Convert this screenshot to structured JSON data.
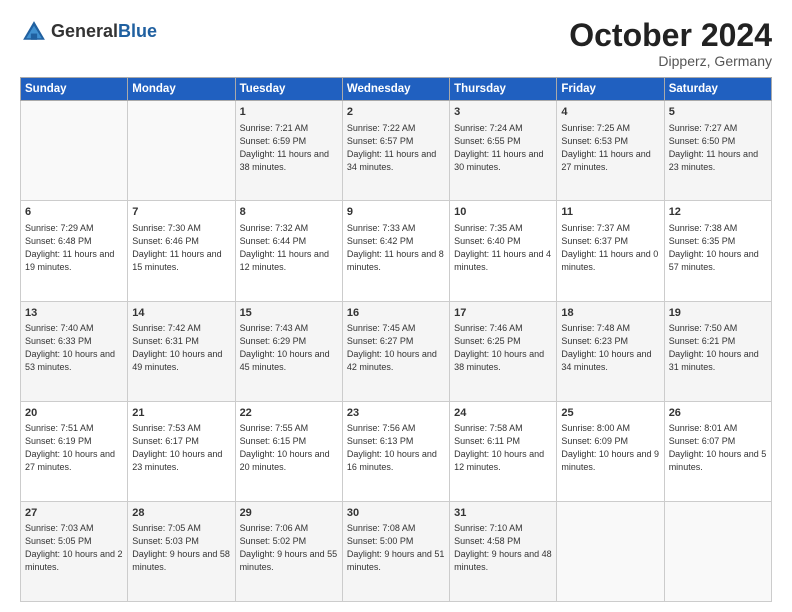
{
  "header": {
    "logo_general": "General",
    "logo_blue": "Blue",
    "month_title": "October 2024",
    "location": "Dipperz, Germany"
  },
  "weekdays": [
    "Sunday",
    "Monday",
    "Tuesday",
    "Wednesday",
    "Thursday",
    "Friday",
    "Saturday"
  ],
  "weeks": [
    [
      {
        "day": "",
        "info": ""
      },
      {
        "day": "",
        "info": ""
      },
      {
        "day": "1",
        "info": "Sunrise: 7:21 AM\nSunset: 6:59 PM\nDaylight: 11 hours and 38 minutes."
      },
      {
        "day": "2",
        "info": "Sunrise: 7:22 AM\nSunset: 6:57 PM\nDaylight: 11 hours and 34 minutes."
      },
      {
        "day": "3",
        "info": "Sunrise: 7:24 AM\nSunset: 6:55 PM\nDaylight: 11 hours and 30 minutes."
      },
      {
        "day": "4",
        "info": "Sunrise: 7:25 AM\nSunset: 6:53 PM\nDaylight: 11 hours and 27 minutes."
      },
      {
        "day": "5",
        "info": "Sunrise: 7:27 AM\nSunset: 6:50 PM\nDaylight: 11 hours and 23 minutes."
      }
    ],
    [
      {
        "day": "6",
        "info": "Sunrise: 7:29 AM\nSunset: 6:48 PM\nDaylight: 11 hours and 19 minutes."
      },
      {
        "day": "7",
        "info": "Sunrise: 7:30 AM\nSunset: 6:46 PM\nDaylight: 11 hours and 15 minutes."
      },
      {
        "day": "8",
        "info": "Sunrise: 7:32 AM\nSunset: 6:44 PM\nDaylight: 11 hours and 12 minutes."
      },
      {
        "day": "9",
        "info": "Sunrise: 7:33 AM\nSunset: 6:42 PM\nDaylight: 11 hours and 8 minutes."
      },
      {
        "day": "10",
        "info": "Sunrise: 7:35 AM\nSunset: 6:40 PM\nDaylight: 11 hours and 4 minutes."
      },
      {
        "day": "11",
        "info": "Sunrise: 7:37 AM\nSunset: 6:37 PM\nDaylight: 11 hours and 0 minutes."
      },
      {
        "day": "12",
        "info": "Sunrise: 7:38 AM\nSunset: 6:35 PM\nDaylight: 10 hours and 57 minutes."
      }
    ],
    [
      {
        "day": "13",
        "info": "Sunrise: 7:40 AM\nSunset: 6:33 PM\nDaylight: 10 hours and 53 minutes."
      },
      {
        "day": "14",
        "info": "Sunrise: 7:42 AM\nSunset: 6:31 PM\nDaylight: 10 hours and 49 minutes."
      },
      {
        "day": "15",
        "info": "Sunrise: 7:43 AM\nSunset: 6:29 PM\nDaylight: 10 hours and 45 minutes."
      },
      {
        "day": "16",
        "info": "Sunrise: 7:45 AM\nSunset: 6:27 PM\nDaylight: 10 hours and 42 minutes."
      },
      {
        "day": "17",
        "info": "Sunrise: 7:46 AM\nSunset: 6:25 PM\nDaylight: 10 hours and 38 minutes."
      },
      {
        "day": "18",
        "info": "Sunrise: 7:48 AM\nSunset: 6:23 PM\nDaylight: 10 hours and 34 minutes."
      },
      {
        "day": "19",
        "info": "Sunrise: 7:50 AM\nSunset: 6:21 PM\nDaylight: 10 hours and 31 minutes."
      }
    ],
    [
      {
        "day": "20",
        "info": "Sunrise: 7:51 AM\nSunset: 6:19 PM\nDaylight: 10 hours and 27 minutes."
      },
      {
        "day": "21",
        "info": "Sunrise: 7:53 AM\nSunset: 6:17 PM\nDaylight: 10 hours and 23 minutes."
      },
      {
        "day": "22",
        "info": "Sunrise: 7:55 AM\nSunset: 6:15 PM\nDaylight: 10 hours and 20 minutes."
      },
      {
        "day": "23",
        "info": "Sunrise: 7:56 AM\nSunset: 6:13 PM\nDaylight: 10 hours and 16 minutes."
      },
      {
        "day": "24",
        "info": "Sunrise: 7:58 AM\nSunset: 6:11 PM\nDaylight: 10 hours and 12 minutes."
      },
      {
        "day": "25",
        "info": "Sunrise: 8:00 AM\nSunset: 6:09 PM\nDaylight: 10 hours and 9 minutes."
      },
      {
        "day": "26",
        "info": "Sunrise: 8:01 AM\nSunset: 6:07 PM\nDaylight: 10 hours and 5 minutes."
      }
    ],
    [
      {
        "day": "27",
        "info": "Sunrise: 7:03 AM\nSunset: 5:05 PM\nDaylight: 10 hours and 2 minutes."
      },
      {
        "day": "28",
        "info": "Sunrise: 7:05 AM\nSunset: 5:03 PM\nDaylight: 9 hours and 58 minutes."
      },
      {
        "day": "29",
        "info": "Sunrise: 7:06 AM\nSunset: 5:02 PM\nDaylight: 9 hours and 55 minutes."
      },
      {
        "day": "30",
        "info": "Sunrise: 7:08 AM\nSunset: 5:00 PM\nDaylight: 9 hours and 51 minutes."
      },
      {
        "day": "31",
        "info": "Sunrise: 7:10 AM\nSunset: 4:58 PM\nDaylight: 9 hours and 48 minutes."
      },
      {
        "day": "",
        "info": ""
      },
      {
        "day": "",
        "info": ""
      }
    ]
  ]
}
